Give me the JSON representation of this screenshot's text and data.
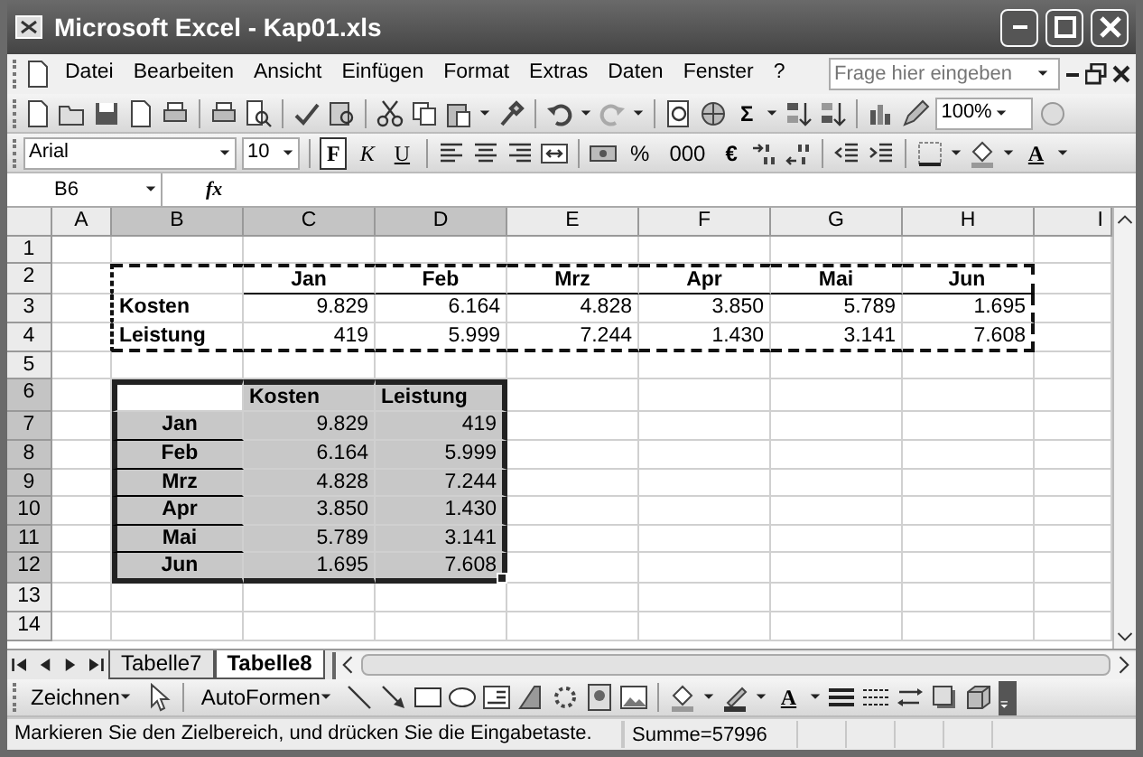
{
  "window": {
    "title": "Microsoft Excel - Kap01.xls"
  },
  "menu": [
    "Datei",
    "Bearbeiten",
    "Ansicht",
    "Einfügen",
    "Format",
    "Extras",
    "Daten",
    "Fenster",
    "?"
  ],
  "help_box": {
    "placeholder": "Frage hier eingeben"
  },
  "standard_toolbar": {
    "sum": "Σ",
    "zoom": "100%"
  },
  "format_toolbar": {
    "font": "Arial",
    "size": "10",
    "buttons": [
      {
        "label": "F",
        "kind": "bold",
        "pressed": true
      },
      {
        "label": "K",
        "kind": "italic",
        "pressed": false
      },
      {
        "label": "U",
        "kind": "underline",
        "pressed": false
      }
    ],
    "percent": "%",
    "thousands": "000",
    "euro": "€",
    "font_color": "A"
  },
  "formula_bar": {
    "name_box": "B6",
    "fx": "fx"
  },
  "sheet": {
    "columns": [
      "A",
      "B",
      "C",
      "D",
      "E",
      "F",
      "G",
      "H",
      "I"
    ],
    "rows": [
      {
        "label": "1"
      },
      {
        "label": "2",
        "cells": [
          {
            "kind": "empty",
            "copied": false
          },
          {
            "kind": "empty",
            "copied": true
          },
          {
            "text": "Jan",
            "kind": "heading",
            "copied": true
          },
          {
            "text": "Feb",
            "kind": "heading",
            "copied": true
          },
          {
            "text": "Mrz",
            "kind": "heading",
            "copied": true
          },
          {
            "text": "Apr",
            "kind": "heading",
            "copied": true
          },
          {
            "text": "Mai",
            "kind": "heading",
            "copied": true
          },
          {
            "text": "Jun",
            "kind": "heading",
            "copied": true
          }
        ]
      },
      {
        "label": "3",
        "cells": [
          {
            "kind": "empty",
            "copied": false
          },
          {
            "text": "Kosten",
            "kind": "label",
            "copied": true
          },
          {
            "text": "9.829",
            "kind": "number",
            "copied": true
          },
          {
            "text": "6.164",
            "kind": "number",
            "copied": true
          },
          {
            "text": "4.828",
            "kind": "number",
            "copied": true
          },
          {
            "text": "3.850",
            "kind": "number",
            "copied": true
          },
          {
            "text": "5.789",
            "kind": "number",
            "copied": true
          },
          {
            "text": "1.695",
            "kind": "number",
            "copied": true
          }
        ]
      },
      {
        "label": "4",
        "cells": [
          {
            "kind": "empty",
            "copied": false
          },
          {
            "text": "Leistung",
            "kind": "label",
            "copied": true
          },
          {
            "text": "419",
            "kind": "number",
            "copied": true
          },
          {
            "text": "5.999",
            "kind": "number",
            "copied": true
          },
          {
            "text": "7.244",
            "kind": "number",
            "copied": true
          },
          {
            "text": "1.430",
            "kind": "number",
            "copied": true
          },
          {
            "text": "3.141",
            "kind": "number",
            "copied": true
          },
          {
            "text": "7.608",
            "kind": "number",
            "copied": true
          }
        ]
      },
      {
        "label": "5"
      },
      {
        "label": "6",
        "cells": [
          {
            "kind": "empty",
            "selected": false
          },
          {
            "kind": "empty",
            "selected": true
          },
          {
            "text": "Kosten",
            "kind": "label",
            "selected": true
          },
          {
            "text": "Leistung",
            "kind": "label",
            "selected": true
          }
        ]
      },
      {
        "label": "7",
        "cells": [
          {
            "kind": "empty",
            "selected": false
          },
          {
            "text": "Jan",
            "kind": "heading",
            "selected": true
          },
          {
            "text": "9.829",
            "kind": "number",
            "selected": true
          },
          {
            "text": "419",
            "kind": "number",
            "selected": true
          }
        ]
      },
      {
        "label": "8",
        "cells": [
          {
            "kind": "empty",
            "selected": false
          },
          {
            "text": "Feb",
            "kind": "heading",
            "selected": true
          },
          {
            "text": "6.164",
            "kind": "number",
            "selected": true
          },
          {
            "text": "5.999",
            "kind": "number",
            "selected": true
          }
        ]
      },
      {
        "label": "9",
        "cells": [
          {
            "kind": "empty",
            "selected": false
          },
          {
            "text": "Mrz",
            "kind": "heading",
            "selected": true
          },
          {
            "text": "4.828",
            "kind": "number",
            "selected": true
          },
          {
            "text": "7.244",
            "kind": "number",
            "selected": true
          }
        ]
      },
      {
        "label": "10",
        "cells": [
          {
            "kind": "empty",
            "selected": false
          },
          {
            "text": "Apr",
            "kind": "heading",
            "selected": true
          },
          {
            "text": "3.850",
            "kind": "number",
            "selected": true
          },
          {
            "text": "1.430",
            "kind": "number",
            "selected": true
          }
        ]
      },
      {
        "label": "11",
        "cells": [
          {
            "kind": "empty",
            "selected": false
          },
          {
            "text": "Mai",
            "kind": "heading",
            "selected": true
          },
          {
            "text": "5.789",
            "kind": "number",
            "selected": true
          },
          {
            "text": "3.141",
            "kind": "number",
            "selected": true
          }
        ]
      },
      {
        "label": "12",
        "cells": [
          {
            "kind": "empty",
            "selected": false
          },
          {
            "text": "Jun",
            "kind": "heading",
            "selected": true
          },
          {
            "text": "1.695",
            "kind": "number",
            "selected": true
          },
          {
            "text": "7.608",
            "kind": "number",
            "selected": true
          }
        ]
      },
      {
        "label": "13"
      },
      {
        "label": "14"
      }
    ]
  },
  "sheet_tabs": [
    {
      "label": "Tabelle7",
      "selected": false
    },
    {
      "label": "Tabelle8",
      "selected": true
    }
  ],
  "drawing_toolbar": {
    "draw": "Zeichnen",
    "autoshapes": "AutoFormen",
    "font_color": "A"
  },
  "status_bar": {
    "message": "Markieren Sie den Zielbereich, und drücken Sie die Eingabetaste.",
    "sum": "Summe=57996"
  }
}
